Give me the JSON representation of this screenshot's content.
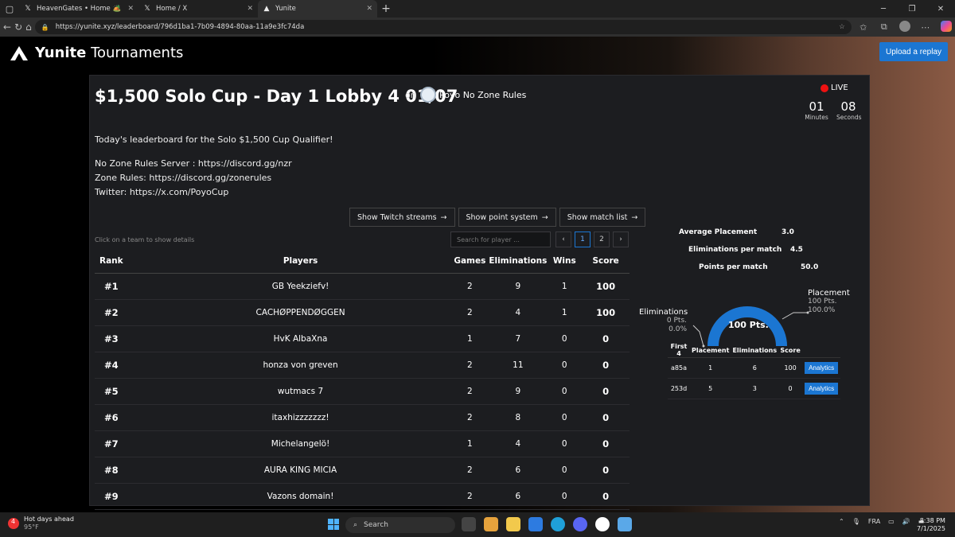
{
  "browser": {
    "tabs": [
      {
        "favicon": "x-logo-icon",
        "title": "HeavenGates • Home 🏕️ / X"
      },
      {
        "favicon": "x-logo-icon",
        "title": "Home / X"
      },
      {
        "favicon": "yunite-logo-icon",
        "title": "Yunite"
      }
    ],
    "url": "https://yunite.xyz/leaderboard/796d1ba1-7b09-4894-80aa-11a9e3fc74da"
  },
  "site": {
    "brand_bold": "Yunite",
    "brand_rest": " Tournaments",
    "upload_label": "Upload a replay"
  },
  "event": {
    "title": "$1,500 Solo Cup - Day 1 Lobby 4 01/07",
    "on": "on",
    "map_name": "Poyo No Zone Rules",
    "live": "LIVE",
    "timer_minutes": "01",
    "timer_seconds": "08",
    "minutes_label": "Minutes",
    "seconds_label": "Seconds",
    "desc_line1": "Today's leaderboard for the Solo $1,500 Cup Qualifier!",
    "desc_line2": "No Zone Rules Server : https://discord.gg/nzr",
    "desc_line3": "Zone Rules: https://discord.gg/zonerules",
    "desc_line4": "Twitter: https://x.com/PoyoCup"
  },
  "actions": {
    "streams": "Show Twitch streams",
    "points": "Show point system",
    "matches": "Show match list"
  },
  "leaderboard": {
    "hint": "Click on a team to show details",
    "search_placeholder": "Search for player ...",
    "pages": [
      "1",
      "2"
    ],
    "current_page": "1",
    "columns": [
      "Rank",
      "Players",
      "Games",
      "Eliminations",
      "Wins",
      "Score"
    ],
    "rows": [
      {
        "rank": "#1",
        "player": "GB Yeekziefv!",
        "games": "2",
        "elims": "9",
        "wins": "1",
        "score": "100"
      },
      {
        "rank": "#2",
        "player": "CACHØPPENDØGGEN",
        "games": "2",
        "elims": "4",
        "wins": "1",
        "score": "100"
      },
      {
        "rank": "#3",
        "player": "HvK AlbaXna",
        "games": "1",
        "elims": "7",
        "wins": "0",
        "score": "0"
      },
      {
        "rank": "#4",
        "player": "honza von greven",
        "games": "2",
        "elims": "11",
        "wins": "0",
        "score": "0"
      },
      {
        "rank": "#5",
        "player": "wutmacs 7",
        "games": "2",
        "elims": "9",
        "wins": "0",
        "score": "0"
      },
      {
        "rank": "#6",
        "player": "itaxhizzzzzzz!",
        "games": "2",
        "elims": "8",
        "wins": "0",
        "score": "0"
      },
      {
        "rank": "#7",
        "player": "Michelangelö!",
        "games": "1",
        "elims": "4",
        "wins": "0",
        "score": "0"
      },
      {
        "rank": "#8",
        "player": "AURA KING MICIA",
        "games": "2",
        "elims": "6",
        "wins": "0",
        "score": "0"
      },
      {
        "rank": "#9",
        "player": "Vazons domain!",
        "games": "2",
        "elims": "6",
        "wins": "0",
        "score": "0"
      }
    ]
  },
  "details": {
    "avg_placement_label": "Average Placement",
    "avg_placement": "3.0",
    "elims_per_match_label": "Eliminations per match",
    "elims_per_match": "4.5",
    "points_per_match_label": "Points per match",
    "points_per_match": "50.0",
    "gauge_center": "100 Pts.",
    "placement_label": "Placement",
    "placement_pts": "100 Pts.",
    "placement_pct": "100.0%",
    "placement_fraction": 1.0,
    "elims_label": "Eliminations",
    "elims_pts": "0 Pts.",
    "elims_pct": "0.0%",
    "match_columns": [
      "First 4",
      "Placement",
      "Eliminations",
      "Score",
      ""
    ],
    "matches": [
      {
        "id": "a85a",
        "placement": "1",
        "elims": "6",
        "score": "100",
        "button": "Analytics"
      },
      {
        "id": "253d",
        "placement": "5",
        "elims": "3",
        "score": "0",
        "button": "Analytics"
      }
    ]
  },
  "taskbar": {
    "weather_title": "Hot days ahead",
    "weather_temp": "95°F",
    "weather_badge": "4",
    "search": "Search",
    "lang": "FRA",
    "time": "8:38 PM",
    "date": "7/1/2025"
  },
  "colors": {
    "accent": "#1b76d2",
    "live": "#ee1111",
    "panel": "#1c1d20"
  }
}
